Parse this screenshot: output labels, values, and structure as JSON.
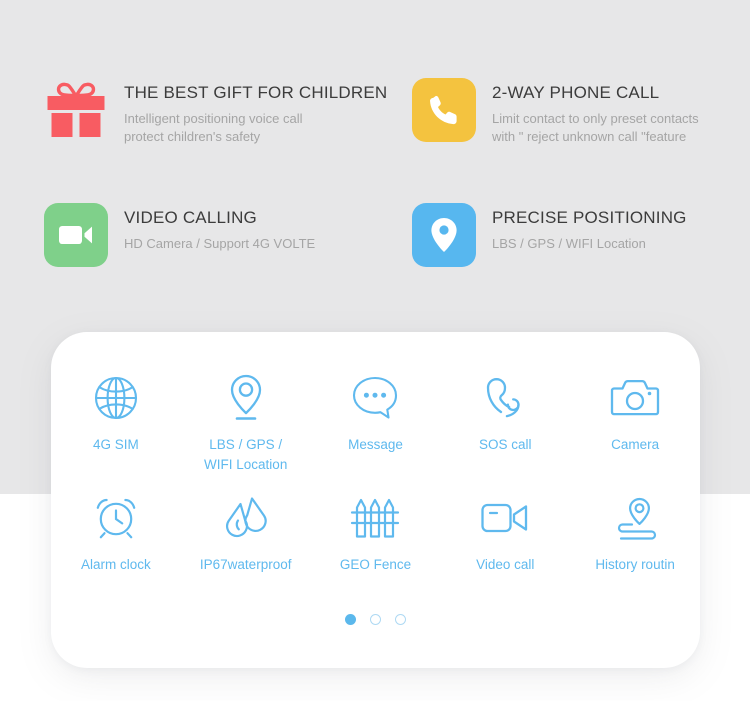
{
  "theme": {
    "page_bg_gray": "#e7e7e8",
    "page_bg_white": "#ffffff",
    "card_bg": "#ffffff",
    "accent_blue": "#5fb9ee",
    "title_color": "#3c3c3c",
    "desc_color": "#a5a5a5",
    "gift_red": "#f85c62",
    "phone_yellow": "#f4c33f",
    "video_green": "#7fd08a",
    "location_blue": "#57b7ef"
  },
  "features": [
    {
      "icon": "gift-icon",
      "icon_color": "#f85c62",
      "icon_style": "plain",
      "title": "THE BEST GIFT FOR CHILDREN",
      "desc": "Intelligent positioning voice call\nprotect children's safety"
    },
    {
      "icon": "phone-call-icon",
      "icon_color": "#f4c33f",
      "icon_style": "tile",
      "title": "2-WAY PHONE CALL",
      "desc": "Limit contact to only preset contacts\nwith \" reject unknown call \"feature"
    },
    {
      "icon": "video-camera-icon",
      "icon_color": "#7fd08a",
      "icon_style": "tile",
      "title": "VIDEO CALLING",
      "desc": "HD Camera / Support 4G VOLTE"
    },
    {
      "icon": "map-pin-icon",
      "icon_color": "#57b7ef",
      "icon_style": "tile",
      "title": "PRECISE POSITIONING",
      "desc": "LBS / GPS /  WIFI Location"
    }
  ],
  "spec_card": {
    "rows": [
      [
        {
          "icon": "globe-icon",
          "label": "4G SIM"
        },
        {
          "icon": "location-pin-icon",
          "label": "LBS / GPS /\nWIFI Location"
        },
        {
          "icon": "message-bubble-icon",
          "label": "Message"
        },
        {
          "icon": "sos-phone-icon",
          "label": "SOS call"
        },
        {
          "icon": "camera-icon",
          "label": "Camera"
        }
      ],
      [
        {
          "icon": "alarm-clock-icon",
          "label": "Alarm clock"
        },
        {
          "icon": "water-drop-icon",
          "label": "IP67waterproof"
        },
        {
          "icon": "fence-icon",
          "label": "GEO Fence"
        },
        {
          "icon": "video-call-icon",
          "label": "Video call"
        },
        {
          "icon": "history-route-icon",
          "label": "History routin"
        }
      ]
    ],
    "pagination": {
      "total": 3,
      "active_index": 0
    }
  }
}
